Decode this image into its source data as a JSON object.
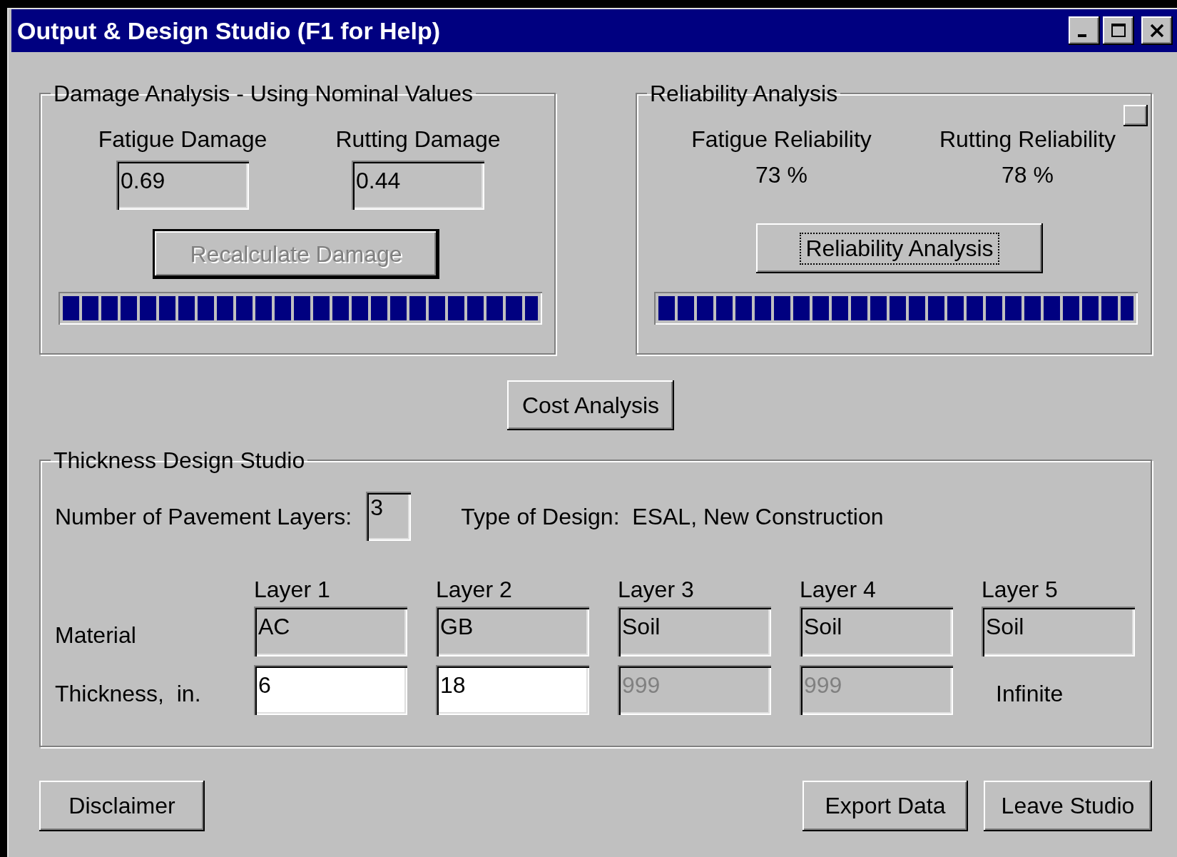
{
  "window": {
    "title": "Output & Design Studio (F1 for Help)"
  },
  "damage_analysis": {
    "title": "Damage Analysis - Using Nominal Values",
    "fields": [
      {
        "label": "Fatigue Damage",
        "value": "0.69"
      },
      {
        "label": "Rutting Damage",
        "value": "0.44"
      }
    ],
    "button": {
      "label": "Recalculate Damage",
      "disabled": true,
      "default": true,
      "focused": false
    },
    "progress": {
      "level": 1
    }
  },
  "reliability_analysis": {
    "title": "Reliability Analysis",
    "results": [
      {
        "label": "Fatigue Reliability",
        "value": "73 %"
      },
      {
        "label": "Rutting Reliability",
        "value": "78 %"
      }
    ],
    "button": {
      "label": "Reliability Analysis",
      "disabled": false,
      "default": false,
      "focused": true
    },
    "progress": {
      "level": 1
    }
  },
  "cost_button": {
    "label": "Cost Analysis"
  },
  "thickness_design": {
    "title": "Thickness Design Studio",
    "layers_label": "Number of Pavement Layers:",
    "layers_value": "3",
    "design_type": "Type of Design:  ESAL, New Construction",
    "row_labels": [
      "Material",
      "Thickness,  in."
    ],
    "layers": [
      {
        "name": "Layer 1",
        "material": "AC",
        "thickness": {
          "kind": "input",
          "value": "6",
          "disabled": false
        }
      },
      {
        "name": "Layer 2",
        "material": "GB",
        "thickness": {
          "kind": "input",
          "value": "18",
          "disabled": false
        }
      },
      {
        "name": "Layer 3",
        "material": "Soil",
        "thickness": {
          "kind": "input",
          "value": "999",
          "disabled": true
        }
      },
      {
        "name": "Layer 4",
        "material": "Soil",
        "thickness": {
          "kind": "input",
          "value": "999",
          "disabled": true
        }
      },
      {
        "name": "Layer 5",
        "material": "Soil",
        "thickness": {
          "kind": "label",
          "value": "Infinite",
          "disabled": false
        }
      }
    ]
  },
  "buttons": [
    {
      "label": "Disclaimer"
    },
    {
      "label": "Export Data"
    },
    {
      "label": "Leave Studio"
    }
  ]
}
